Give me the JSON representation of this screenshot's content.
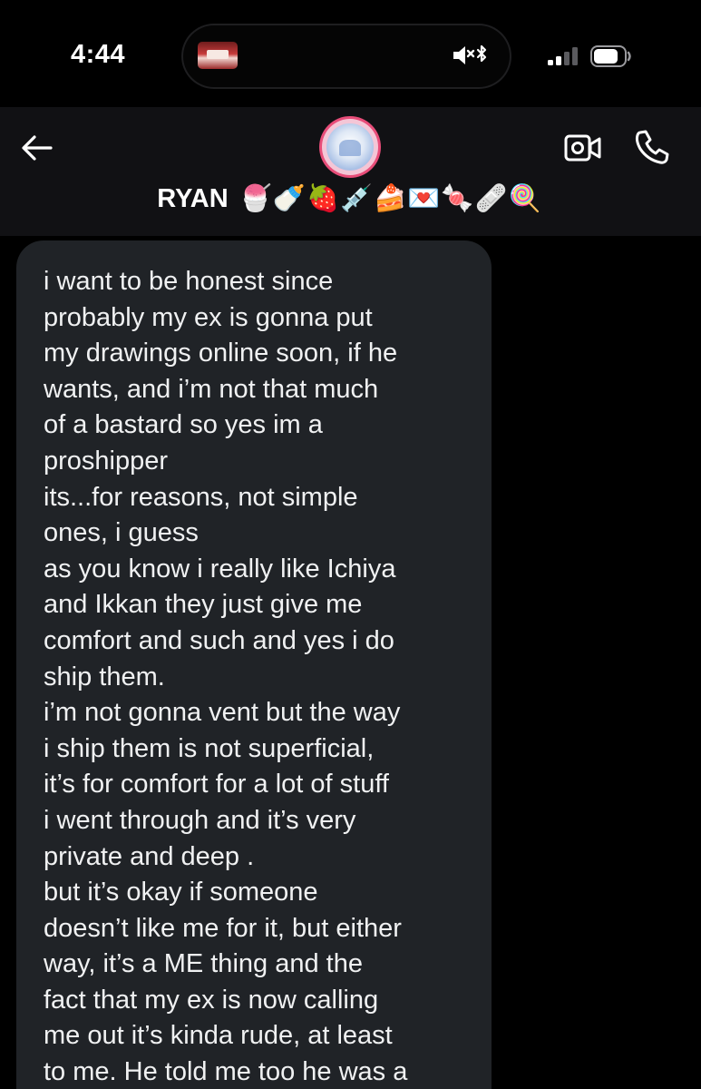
{
  "status_bar": {
    "time": "4:44"
  },
  "header": {
    "contact_name": "RYAN",
    "name_emojis": "🍧🍼🍓💉🍰💌🍬🩹🍭",
    "icons": {
      "back": "arrow-left-icon",
      "video": "video-camera-icon",
      "call": "phone-icon"
    }
  },
  "message": {
    "text": "i want to be honest since\nprobably my ex is gonna put\nmy drawings online soon, if he\nwants, and i’m not that much\nof a bastard so yes im a\nproshipper\nits...for reasons, not simple\nones, i guess\nas you know i really like Ichiya\nand Ikkan they just give me\ncomfort and such and yes i do\nship them.\ni’m not gonna vent but the way\ni ship them is not superficial,\nit’s for comfort for a lot of stuff\ni went through and it’s very\nprivate and deep .\nbut it’s okay if someone\ndoesn’t like me for it, but either\nway, it’s a ME thing and the\nfact that my ex is now calling\nme out it’s kinda rude, at least\nto me. He told me too he was a"
  },
  "colors": {
    "background": "#000000",
    "header_bg": "#111114",
    "bubble_bg": "#202327",
    "text": "#f0f1f2",
    "avatar_ring": "#e84d79"
  }
}
